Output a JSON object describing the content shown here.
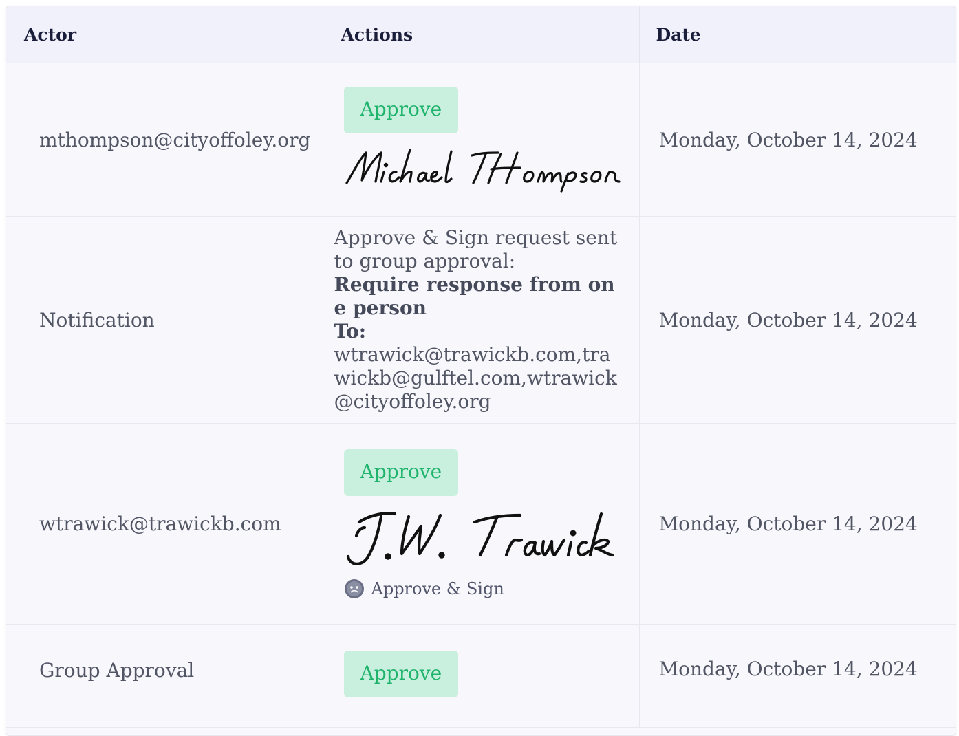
{
  "table": {
    "headers": [
      "Actor",
      "Actions",
      "Date"
    ],
    "rows": [
      {
        "actor": "mthompson@cityoffoley.org",
        "approve_label": "Approve",
        "signature": "Michael THompson",
        "date": "Monday, October 14, 2024"
      },
      {
        "actor": "Notification",
        "notification_text": "Approve & Sign request sent to group approval:",
        "notification_bold": "Require response from one person",
        "to_label": "To:",
        "to_emails": "wtrawick@trawickb.com,trawickb@gulftel.com,wtrawick@cityoffoley.org",
        "date": "Monday, October 14, 2024"
      },
      {
        "actor": "wtrawick@trawickb.com",
        "approve_label": "Approve",
        "signature": "J.W. Trawick",
        "sign_label": "Approve & Sign",
        "sign_icon": "face-icon",
        "date": "Monday, October 14, 2024"
      },
      {
        "actor": "Group Approval",
        "approve_label": "Approve",
        "date": "Monday, October 14, 2024"
      }
    ]
  },
  "colors": {
    "approve_bg": "#c9efdf",
    "approve_text": "#1fb36b",
    "header_bg": "#f0f1fb"
  }
}
